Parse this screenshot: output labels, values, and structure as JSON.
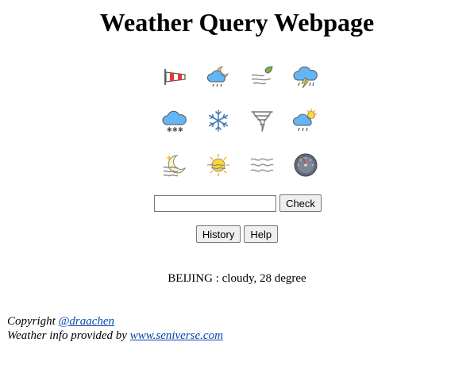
{
  "page": {
    "title": "Weather Query Webpage"
  },
  "icons": [
    {
      "name": "windsock-icon"
    },
    {
      "name": "partly-cloudy-night-rain-icon"
    },
    {
      "name": "wind-leaf-icon"
    },
    {
      "name": "thunderstorm-icon"
    },
    {
      "name": "snow-cloud-icon"
    },
    {
      "name": "snowflake-icon"
    },
    {
      "name": "tornado-icon"
    },
    {
      "name": "sun-cloud-rain-icon"
    },
    {
      "name": "night-fog-icon"
    },
    {
      "name": "sun-haze-icon"
    },
    {
      "name": "fog-waves-icon"
    },
    {
      "name": "barometer-icon"
    }
  ],
  "query": {
    "input_value": "",
    "check_label": "Check"
  },
  "buttons": {
    "history_label": "History",
    "help_label": "Help"
  },
  "result": {
    "text": "BEIJING : cloudy, 28 degree"
  },
  "footer": {
    "copyright_prefix": "Copyright ",
    "author_link": "@draachen",
    "provider_prefix": "Weather info provided by ",
    "provider_link": "www.seniverse.com"
  }
}
